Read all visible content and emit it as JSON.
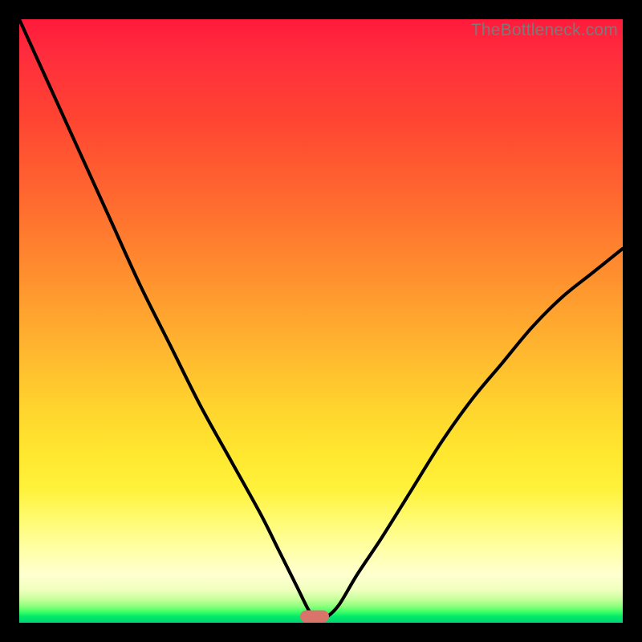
{
  "watermark": "TheBottleneck.com",
  "colors": {
    "frame": "#000000",
    "curve": "#000000",
    "marker": "#d9746b",
    "gradient_top": "#ff1a3c",
    "gradient_bottom": "#00d473"
  },
  "chart_data": {
    "type": "line",
    "title": "",
    "xlabel": "",
    "ylabel": "",
    "xlim": [
      0,
      100
    ],
    "ylim": [
      0,
      100
    ],
    "note": "No axis ticks, labels, or gridlines are shown; values are read as percentages of plot width/height. Curve plunges from top-left to a minimum near x≈49 (y≈1), flattens briefly, then rises toward the right reaching y≈62 at x=100.",
    "series": [
      {
        "name": "bottleneck-curve",
        "x": [
          0,
          5,
          10,
          15,
          20,
          25,
          30,
          35,
          40,
          43,
          46,
          48,
          49,
          50,
          51,
          53,
          56,
          60,
          65,
          70,
          75,
          80,
          85,
          90,
          95,
          100
        ],
        "y": [
          100,
          89,
          78,
          67,
          56,
          46,
          36,
          27,
          18,
          12,
          6,
          2,
          1,
          1,
          1,
          3,
          8,
          14,
          22,
          30,
          37,
          43,
          49,
          54,
          58,
          62
        ]
      }
    ],
    "marker": {
      "x": 49,
      "y": 1,
      "shape": "rounded-bar"
    }
  }
}
